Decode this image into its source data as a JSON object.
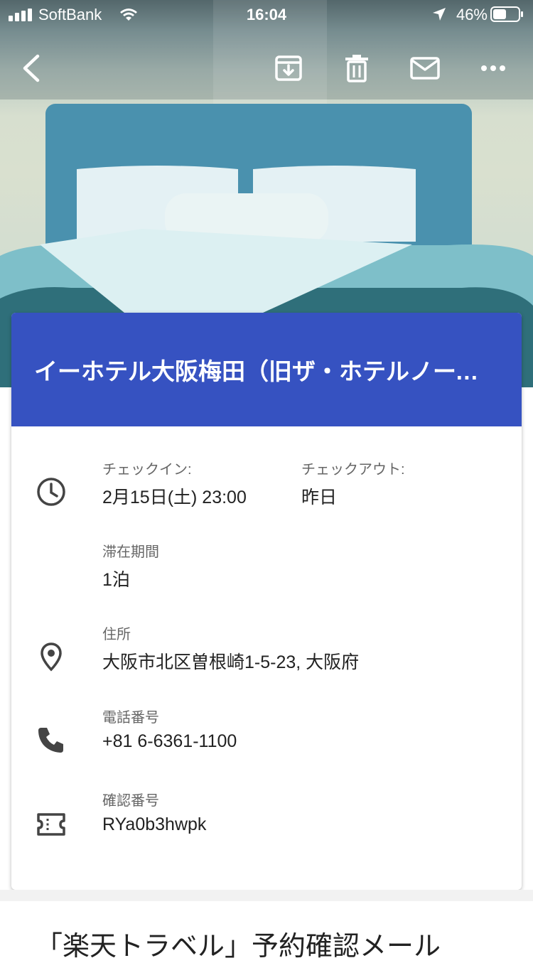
{
  "status_bar": {
    "carrier": "SoftBank",
    "time": "16:04",
    "battery": "46%"
  },
  "toolbar": {
    "back_icon": "chevron-left-icon",
    "archive_icon": "archive-icon",
    "delete_icon": "trash-icon",
    "mail_icon": "mail-icon",
    "more_icon": "more-horizontal-icon"
  },
  "card": {
    "title": "イーホテル大阪梅田（旧ザ・ホテルノース…",
    "header_color": "#3652c1",
    "checkin_label": "チェックイン:",
    "checkin_value": "2月15日(土) 23:00",
    "checkout_label": "チェックアウト:",
    "checkout_value": "昨日",
    "stay_label": "滞在期間",
    "stay_value": "1泊",
    "address_label": "住所",
    "address_value": "大阪市北区曽根崎1-5-23, 大阪府",
    "phone_label": "電話番号",
    "phone_value": "+81 6-6361-1100",
    "confirmation_label": "確認番号",
    "confirmation_value": "RYa0b3hwpk"
  },
  "email": {
    "subject": "「楽天トラベル」予約確認メール"
  }
}
